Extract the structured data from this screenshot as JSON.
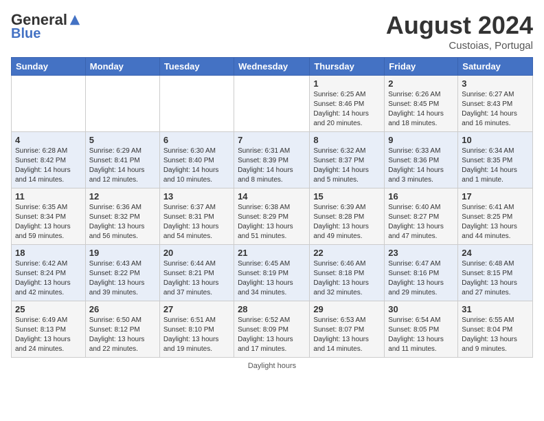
{
  "header": {
    "logo_general": "General",
    "logo_blue": "Blue",
    "month_year": "August 2024",
    "location": "Custoias, Portugal"
  },
  "days_of_week": [
    "Sunday",
    "Monday",
    "Tuesday",
    "Wednesday",
    "Thursday",
    "Friday",
    "Saturday"
  ],
  "weeks": [
    [
      {
        "day": "",
        "content": ""
      },
      {
        "day": "",
        "content": ""
      },
      {
        "day": "",
        "content": ""
      },
      {
        "day": "",
        "content": ""
      },
      {
        "day": "1",
        "content": "Sunrise: 6:25 AM\nSunset: 8:46 PM\nDaylight: 14 hours and 20 minutes."
      },
      {
        "day": "2",
        "content": "Sunrise: 6:26 AM\nSunset: 8:45 PM\nDaylight: 14 hours and 18 minutes."
      },
      {
        "day": "3",
        "content": "Sunrise: 6:27 AM\nSunset: 8:43 PM\nDaylight: 14 hours and 16 minutes."
      }
    ],
    [
      {
        "day": "4",
        "content": "Sunrise: 6:28 AM\nSunset: 8:42 PM\nDaylight: 14 hours and 14 minutes."
      },
      {
        "day": "5",
        "content": "Sunrise: 6:29 AM\nSunset: 8:41 PM\nDaylight: 14 hours and 12 minutes."
      },
      {
        "day": "6",
        "content": "Sunrise: 6:30 AM\nSunset: 8:40 PM\nDaylight: 14 hours and 10 minutes."
      },
      {
        "day": "7",
        "content": "Sunrise: 6:31 AM\nSunset: 8:39 PM\nDaylight: 14 hours and 8 minutes."
      },
      {
        "day": "8",
        "content": "Sunrise: 6:32 AM\nSunset: 8:37 PM\nDaylight: 14 hours and 5 minutes."
      },
      {
        "day": "9",
        "content": "Sunrise: 6:33 AM\nSunset: 8:36 PM\nDaylight: 14 hours and 3 minutes."
      },
      {
        "day": "10",
        "content": "Sunrise: 6:34 AM\nSunset: 8:35 PM\nDaylight: 14 hours and 1 minute."
      }
    ],
    [
      {
        "day": "11",
        "content": "Sunrise: 6:35 AM\nSunset: 8:34 PM\nDaylight: 13 hours and 59 minutes."
      },
      {
        "day": "12",
        "content": "Sunrise: 6:36 AM\nSunset: 8:32 PM\nDaylight: 13 hours and 56 minutes."
      },
      {
        "day": "13",
        "content": "Sunrise: 6:37 AM\nSunset: 8:31 PM\nDaylight: 13 hours and 54 minutes."
      },
      {
        "day": "14",
        "content": "Sunrise: 6:38 AM\nSunset: 8:29 PM\nDaylight: 13 hours and 51 minutes."
      },
      {
        "day": "15",
        "content": "Sunrise: 6:39 AM\nSunset: 8:28 PM\nDaylight: 13 hours and 49 minutes."
      },
      {
        "day": "16",
        "content": "Sunrise: 6:40 AM\nSunset: 8:27 PM\nDaylight: 13 hours and 47 minutes."
      },
      {
        "day": "17",
        "content": "Sunrise: 6:41 AM\nSunset: 8:25 PM\nDaylight: 13 hours and 44 minutes."
      }
    ],
    [
      {
        "day": "18",
        "content": "Sunrise: 6:42 AM\nSunset: 8:24 PM\nDaylight: 13 hours and 42 minutes."
      },
      {
        "day": "19",
        "content": "Sunrise: 6:43 AM\nSunset: 8:22 PM\nDaylight: 13 hours and 39 minutes."
      },
      {
        "day": "20",
        "content": "Sunrise: 6:44 AM\nSunset: 8:21 PM\nDaylight: 13 hours and 37 minutes."
      },
      {
        "day": "21",
        "content": "Sunrise: 6:45 AM\nSunset: 8:19 PM\nDaylight: 13 hours and 34 minutes."
      },
      {
        "day": "22",
        "content": "Sunrise: 6:46 AM\nSunset: 8:18 PM\nDaylight: 13 hours and 32 minutes."
      },
      {
        "day": "23",
        "content": "Sunrise: 6:47 AM\nSunset: 8:16 PM\nDaylight: 13 hours and 29 minutes."
      },
      {
        "day": "24",
        "content": "Sunrise: 6:48 AM\nSunset: 8:15 PM\nDaylight: 13 hours and 27 minutes."
      }
    ],
    [
      {
        "day": "25",
        "content": "Sunrise: 6:49 AM\nSunset: 8:13 PM\nDaylight: 13 hours and 24 minutes."
      },
      {
        "day": "26",
        "content": "Sunrise: 6:50 AM\nSunset: 8:12 PM\nDaylight: 13 hours and 22 minutes."
      },
      {
        "day": "27",
        "content": "Sunrise: 6:51 AM\nSunset: 8:10 PM\nDaylight: 13 hours and 19 minutes."
      },
      {
        "day": "28",
        "content": "Sunrise: 6:52 AM\nSunset: 8:09 PM\nDaylight: 13 hours and 17 minutes."
      },
      {
        "day": "29",
        "content": "Sunrise: 6:53 AM\nSunset: 8:07 PM\nDaylight: 13 hours and 14 minutes."
      },
      {
        "day": "30",
        "content": "Sunrise: 6:54 AM\nSunset: 8:05 PM\nDaylight: 13 hours and 11 minutes."
      },
      {
        "day": "31",
        "content": "Sunrise: 6:55 AM\nSunset: 8:04 PM\nDaylight: 13 hours and 9 minutes."
      }
    ]
  ],
  "footer": "Daylight hours"
}
